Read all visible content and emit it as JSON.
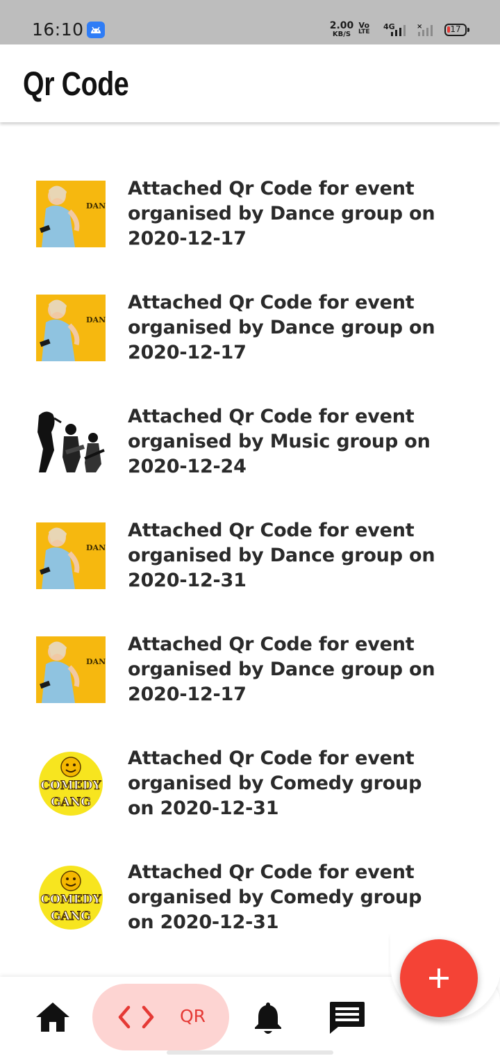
{
  "status_bar": {
    "time": "16:10",
    "net_speed_value": "2.00",
    "net_speed_unit": "KB/S",
    "volte_top": "Vo",
    "volte_bottom": "LTE",
    "network_type": "4G",
    "battery_level": "17",
    "battery_color": "#e53935"
  },
  "app_bar": {
    "title": "Qr Code"
  },
  "list": {
    "items": [
      {
        "text": "Attached Qr Code for event organised by Dance group on 2020-12-17",
        "thumbnail": "dance-poster"
      },
      {
        "text": "Attached Qr Code for event organised by Dance group on 2020-12-17",
        "thumbnail": "dance-poster"
      },
      {
        "text": "Attached Qr Code for event organised by Music group on 2020-12-24",
        "thumbnail": "music-band-sketch"
      },
      {
        "text": "Attached Qr Code for event organised by Dance group on 2020-12-31",
        "thumbnail": "dance-poster"
      },
      {
        "text": "Attached Qr Code for event organised by Dance group on 2020-12-17",
        "thumbnail": "dance-poster"
      },
      {
        "text": "Attached Qr Code for event organised by Comedy group on 2020-12-31",
        "thumbnail": "comedy-gang-logo"
      },
      {
        "text": "Attached Qr Code for event organised by Comedy group on 2020-12-31",
        "thumbnail": "comedy-gang-logo"
      }
    ]
  },
  "thumbnail_text": {
    "dance": "DAN TE NAM",
    "comedy_top": "COMEDY",
    "comedy_bottom": "GANG"
  },
  "bottom_nav": {
    "home_icon": "home-icon",
    "qr_code_icon": "code-icon",
    "qr_label": "QR",
    "notifications_icon": "bell-icon",
    "messages_icon": "chat-icon",
    "active_color": "#e53935",
    "active_pill_color": "#fdd4d2"
  },
  "fab": {
    "icon": "plus-icon",
    "color": "#f44336"
  }
}
